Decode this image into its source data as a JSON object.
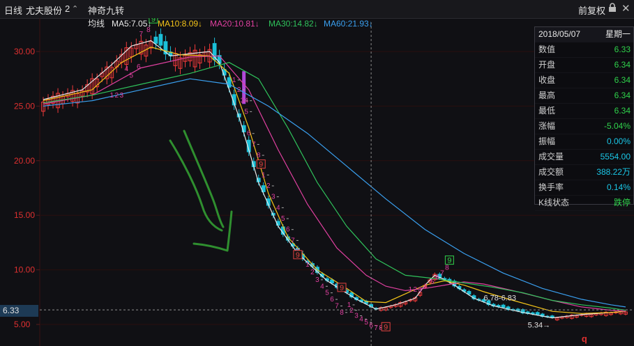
{
  "topbar": {
    "period": "日线",
    "stock_name": "尤夫股份",
    "count": "2",
    "indicator_name": "神奇九转",
    "right_label": "前复权"
  },
  "ma_bar": {
    "avg_label": "均线",
    "items": [
      {
        "label": "MA5:7.05",
        "color": "#e8e8e8"
      },
      {
        "label": "MA10:8.09",
        "color": "#f5c518"
      },
      {
        "label": "MA20:10.81",
        "color": "#e040a0"
      },
      {
        "label": "MA30:14.82",
        "color": "#2fc25b"
      },
      {
        "label": "MA60:21.93",
        "color": "#3aa0f0"
      }
    ]
  },
  "info_panel": {
    "date": "2018/05/07",
    "weekday": "星期一",
    "rows": [
      {
        "label": "数值",
        "value": "6.33",
        "tone": "green"
      },
      {
        "label": "开盘",
        "value": "6.34",
        "tone": "green"
      },
      {
        "label": "收盘",
        "value": "6.34",
        "tone": "green"
      },
      {
        "label": "最高",
        "value": "6.34",
        "tone": "green"
      },
      {
        "label": "最低",
        "value": "6.34",
        "tone": "green"
      },
      {
        "label": "涨幅",
        "value": "-5.04%",
        "tone": "green"
      },
      {
        "label": "振幅",
        "value": "0.00%",
        "tone": "cyan"
      },
      {
        "label": "成交量",
        "value": "5554.00",
        "tone": "cyan"
      },
      {
        "label": "成交额",
        "value": "388.22万",
        "tone": "cyan"
      },
      {
        "label": "换手率",
        "value": "0.14%",
        "tone": "cyan"
      },
      {
        "label": "K线状态",
        "value": "跌停",
        "tone": "green"
      }
    ]
  },
  "price_tag": "6.33",
  "chart_data": {
    "type": "line",
    "title": "",
    "y_ticks": [
      5,
      10,
      15,
      20,
      25,
      30
    ],
    "y_tick_labels": [
      "5.00",
      "10.00",
      "15.00",
      "20.00",
      "25.00",
      "30.00"
    ],
    "ylim": [
      3.6,
      34
    ],
    "x_count": 120,
    "current_price": 6.33,
    "colors": {
      "up": "#f23a3a",
      "down": "#1bc0d8",
      "ma5": "#e8e8e8",
      "ma10": "#f5c518",
      "ma20": "#e040a0",
      "ma30": "#2fc25b",
      "ma60": "#3aa0f0",
      "grid": "#2a0e0e"
    },
    "series": [
      {
        "name": "MA5",
        "x": [
          0,
          8,
          14,
          18,
          22,
          26,
          30,
          34,
          36,
          40,
          44,
          48,
          52,
          58,
          64,
          68,
          72,
          76,
          78,
          80,
          82,
          84,
          86,
          88,
          92,
          98,
          104,
          110,
          116,
          119
        ],
        "y": [
          25.6,
          26.5,
          28.8,
          30.5,
          31,
          29.6,
          29.8,
          30,
          29,
          24,
          18,
          14,
          11.5,
          9,
          7.3,
          6.4,
          6.8,
          7.4,
          8.6,
          9.5,
          9.1,
          8.6,
          8.0,
          7.4,
          6.7,
          6.1,
          5.6,
          5.9,
          6.1,
          6.2
        ]
      },
      {
        "name": "MA10",
        "x": [
          0,
          10,
          16,
          22,
          28,
          34,
          38,
          42,
          46,
          50,
          56,
          62,
          66,
          70,
          74,
          78,
          82,
          86,
          90,
          96,
          104,
          110,
          116,
          119
        ],
        "y": [
          25.5,
          26.5,
          29,
          30.4,
          29.7,
          29.6,
          28,
          23,
          17,
          13,
          10,
          8.3,
          7.1,
          7.0,
          7.8,
          8.6,
          9.0,
          8.6,
          8.0,
          7.2,
          6.2,
          6.0,
          6.1,
          6.2
        ]
      },
      {
        "name": "MA20",
        "x": [
          0,
          10,
          20,
          30,
          36,
          42,
          48,
          54,
          60,
          66,
          70,
          74,
          78,
          82,
          86,
          90,
          96,
          104,
          110,
          116,
          119
        ],
        "y": [
          25.2,
          26,
          28.5,
          29.5,
          29.6,
          26.5,
          21,
          16,
          12,
          9.5,
          8.5,
          8.1,
          8.3,
          8.6,
          8.9,
          8.7,
          8.1,
          7.2,
          6.6,
          6.3,
          6.2
        ]
      },
      {
        "name": "MA30",
        "x": [
          0,
          10,
          20,
          30,
          38,
          44,
          50,
          56,
          62,
          68,
          74,
          80,
          86,
          92,
          98,
          104,
          110,
          116,
          119
        ],
        "y": [
          25.3,
          26,
          27,
          28,
          29,
          27.5,
          23,
          18,
          14,
          11,
          9.5,
          9.2,
          8.8,
          8.4,
          7.9,
          7.2,
          6.8,
          6.5,
          6.3
        ]
      },
      {
        "name": "MA60",
        "x": [
          0,
          10,
          20,
          30,
          38,
          46,
          54,
          62,
          70,
          78,
          86,
          94,
          102,
          110,
          116,
          119
        ],
        "y": [
          25,
          25.5,
          26.5,
          27.5,
          27,
          25,
          22.5,
          19.5,
          16.5,
          13.7,
          11.5,
          9.7,
          8.3,
          7.3,
          6.8,
          6.6
        ]
      }
    ],
    "annotations": [
      {
        "text": "←31.69",
        "x": 14,
        "y": 33.2,
        "color": "#e0e0e0"
      },
      {
        "text": "6.78-6.83",
        "x": 90,
        "y": 7.2,
        "color": "#e0e0e0"
      },
      {
        "text": "5.34→",
        "x": 99,
        "y": 4.7,
        "color": "#e0e0e0"
      }
    ],
    "nine_turn_up": [
      {
        "text": "1",
        "x": 14,
        "y": 25.8
      },
      {
        "text": "2",
        "x": 15,
        "y": 25.8
      },
      {
        "text": "3",
        "x": 16,
        "y": 25.8
      },
      {
        "text": "4",
        "x": 17,
        "y": 28.2
      },
      {
        "text": "5",
        "x": 18,
        "y": 27.6
      },
      {
        "text": "6",
        "x": 19.5,
        "y": 28.4
      },
      {
        "text": "7",
        "x": 20,
        "y": 31.4
      },
      {
        "text": "8",
        "x": 21.5,
        "y": 31.8
      },
      {
        "text": "1",
        "x": 75,
        "y": 8.0
      },
      {
        "text": "2",
        "x": 76,
        "y": 8.0
      },
      {
        "text": "3",
        "x": 77,
        "y": 8.0
      },
      {
        "text": "4",
        "x": 78,
        "y": 8.3
      },
      {
        "text": "5",
        "x": 79.5,
        "y": 8.7
      },
      {
        "text": "6",
        "x": 80.5,
        "y": 9.1
      },
      {
        "text": "7",
        "x": 81.5,
        "y": 9.5
      },
      {
        "text": "8",
        "x": 82.5,
        "y": 10
      }
    ],
    "nine_turn_down": [
      {
        "text": "1",
        "x": 39,
        "y": 27.2
      },
      {
        "text": "2",
        "x": 40,
        "y": 26.3
      },
      {
        "text": "3",
        "x": 40.7,
        "y": 25.3
      },
      {
        "text": "4",
        "x": 41.5,
        "y": 25.3
      },
      {
        "text": "5",
        "x": 41.5,
        "y": 24.3
      },
      {
        "text": "6",
        "x": 42,
        "y": 22.3
      },
      {
        "text": "7",
        "x": 43,
        "y": 21.3
      },
      {
        "text": "8",
        "x": 44,
        "y": 20.3
      },
      {
        "text": "1",
        "x": 45,
        "y": 18.5
      },
      {
        "text": "2",
        "x": 46,
        "y": 17.5
      },
      {
        "text": "3",
        "x": 47,
        "y": 16.5
      },
      {
        "text": "4",
        "x": 48,
        "y": 15.5
      },
      {
        "text": "5",
        "x": 49,
        "y": 14.5
      },
      {
        "text": "6",
        "x": 50,
        "y": 13.5
      },
      {
        "text": "7",
        "x": 51,
        "y": 12.5
      },
      {
        "text": "8",
        "x": 52,
        "y": 11.5
      },
      {
        "text": "1",
        "x": 54,
        "y": 10.3
      },
      {
        "text": "2",
        "x": 55,
        "y": 9.6
      },
      {
        "text": "3",
        "x": 56,
        "y": 8.9
      },
      {
        "text": "4",
        "x": 57,
        "y": 8.3
      },
      {
        "text": "5",
        "x": 58,
        "y": 7.7
      },
      {
        "text": "6",
        "x": 59,
        "y": 7.1
      },
      {
        "text": "7",
        "x": 60,
        "y": 6.5
      },
      {
        "text": "8",
        "x": 61,
        "y": 5.9
      },
      {
        "text": "1",
        "x": 62.5,
        "y": 6.6
      },
      {
        "text": "2",
        "x": 63,
        "y": 6.1
      },
      {
        "text": "3",
        "x": 64,
        "y": 5.6
      },
      {
        "text": "4",
        "x": 65,
        "y": 5.3
      },
      {
        "text": "5",
        "x": 66,
        "y": 5.0
      },
      {
        "text": "6",
        "x": 67,
        "y": 4.7
      },
      {
        "text": "7",
        "x": 68,
        "y": 4.5
      },
      {
        "text": "8",
        "x": 69,
        "y": 4.5
      }
    ],
    "nine_markers": [
      {
        "text": "9",
        "x": 22.5,
        "y": 32.8,
        "kind": "top"
      },
      {
        "text": "9",
        "x": 44.5,
        "y": 19.5,
        "kind": "bottom"
      },
      {
        "text": "9",
        "x": 52,
        "y": 11.2,
        "kind": "bottom"
      },
      {
        "text": "9",
        "x": 61,
        "y": 8.2,
        "kind": "bottom"
      },
      {
        "text": "9",
        "x": 70,
        "y": 4.6,
        "kind": "bottom"
      },
      {
        "text": "9",
        "x": 83,
        "y": 10.7,
        "kind": "top"
      }
    ],
    "bottom_marker": {
      "text": "q",
      "x": 110,
      "y": 4.3
    },
    "cursor_x": 67
  }
}
